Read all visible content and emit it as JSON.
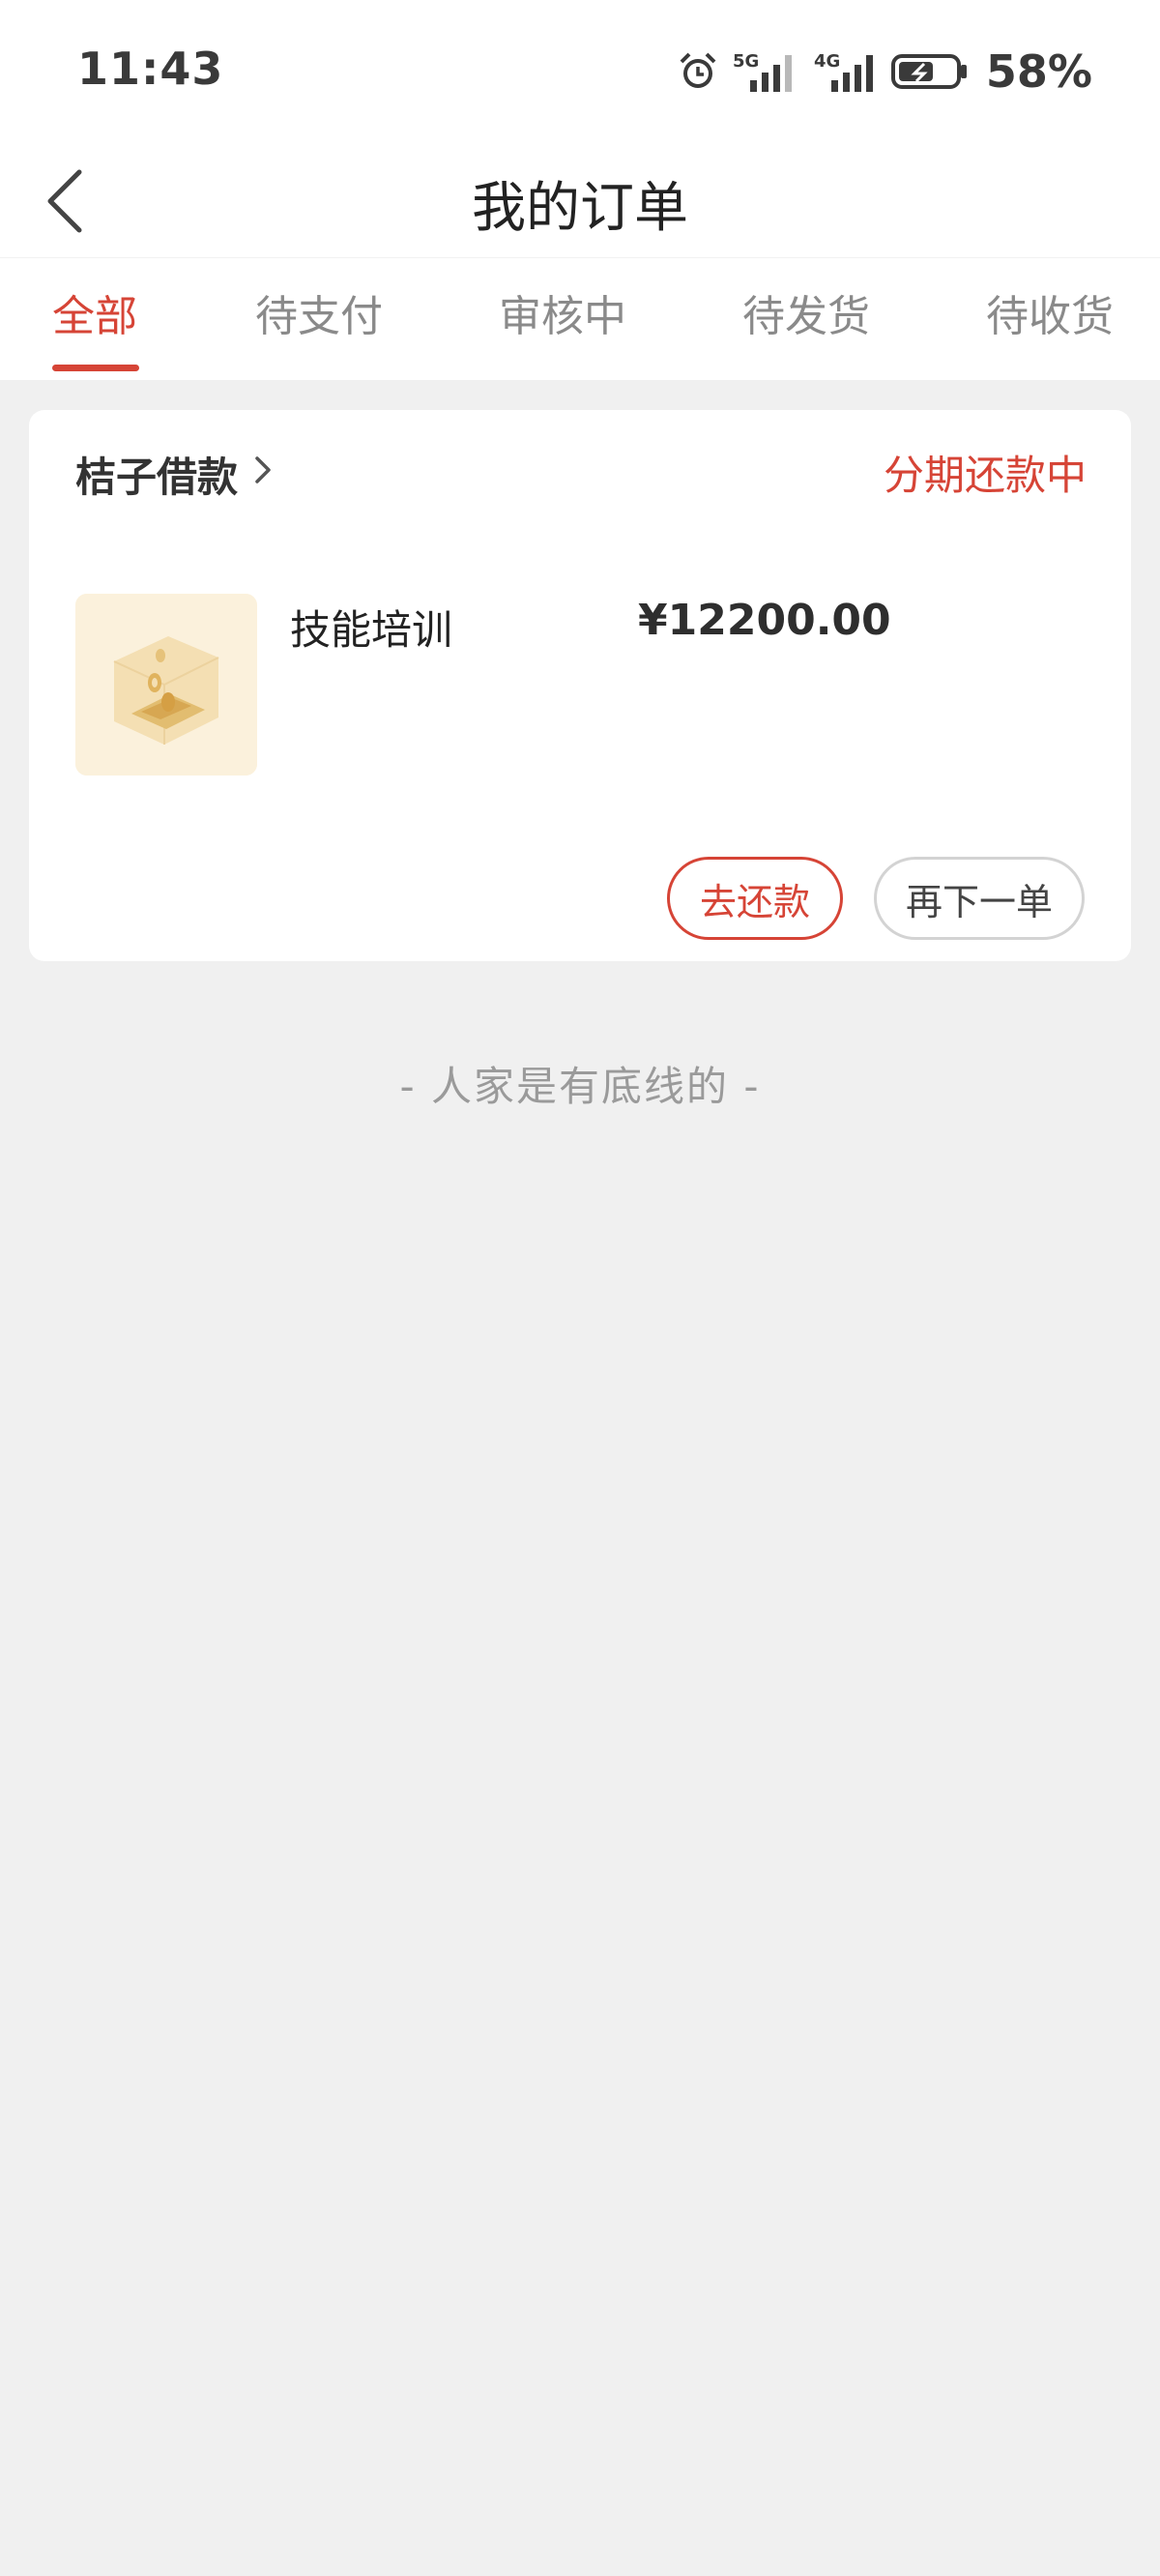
{
  "status_bar": {
    "time": "11:43",
    "network_1": "5G",
    "network_2": "4G",
    "battery_percent": "58%"
  },
  "header": {
    "title": "我的订单"
  },
  "tabs": [
    {
      "label": "全部",
      "active": true
    },
    {
      "label": "待支付",
      "active": false
    },
    {
      "label": "审核中",
      "active": false
    },
    {
      "label": "待发货",
      "active": false
    },
    {
      "label": "待收货",
      "active": false
    }
  ],
  "order": {
    "merchant": "桔子借款",
    "status": "分期还款中",
    "product_name": "技能培训",
    "price": "¥12200.00",
    "repay_button": "去还款",
    "reorder_button": "再下一单"
  },
  "end_tip": "- 人家是有底线的 -",
  "colors": {
    "accent": "#d64436",
    "background": "#f0f0f0",
    "card": "#ffffff"
  },
  "icons": [
    "back-arrow-icon",
    "chevron-right-icon",
    "alarm-icon",
    "signal-icon",
    "battery-icon"
  ]
}
